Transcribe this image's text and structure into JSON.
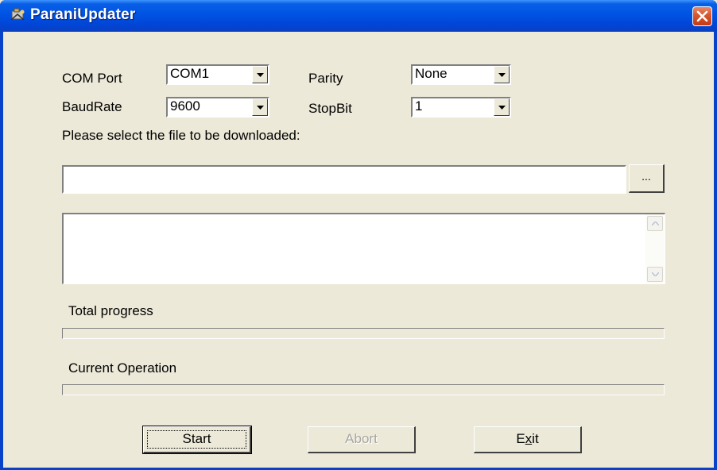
{
  "window": {
    "title": "ParaniUpdater"
  },
  "settings": {
    "com_port": {
      "label": "COM Port",
      "value": "COM1"
    },
    "parity": {
      "label": "Parity",
      "value": "None"
    },
    "baud_rate": {
      "label": "BaudRate",
      "value": "9600"
    },
    "stop_bit": {
      "label": "StopBit",
      "value": "1"
    }
  },
  "file": {
    "prompt": "Please select the file to be downloaded:",
    "path_value": "",
    "browse_label": "..."
  },
  "log": {
    "text": ""
  },
  "progress": {
    "total_label": "Total progress",
    "total_value": 0,
    "current_label": "Current Operation",
    "current_value": 0
  },
  "buttons": {
    "start": "Start",
    "abort": "Abort",
    "exit": "Exit",
    "exit_mnemonic": "x"
  },
  "colors": {
    "titlebar": "#0055e5",
    "window_bg": "#ece9d8",
    "close": "#d85a32"
  }
}
